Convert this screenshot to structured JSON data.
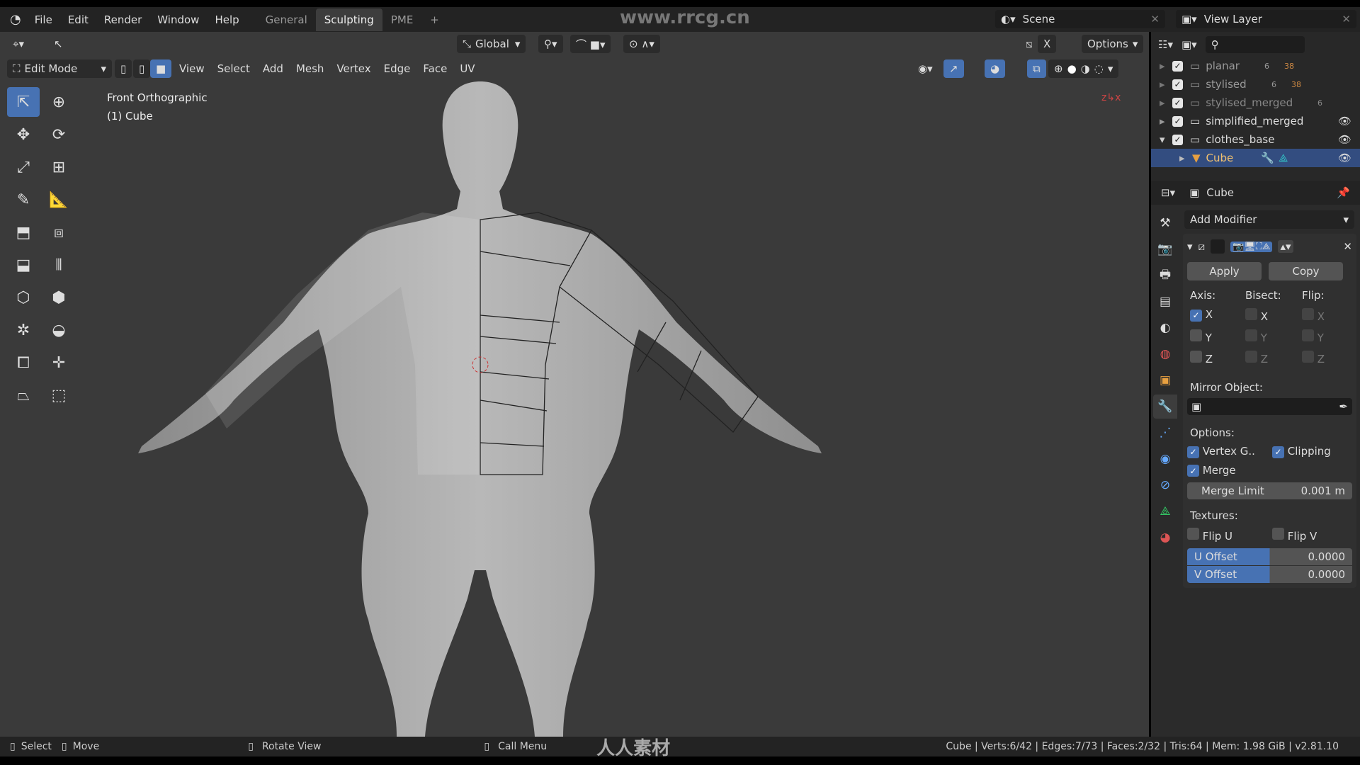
{
  "topbar": {
    "menus": [
      "File",
      "Edit",
      "Render",
      "Window",
      "Help"
    ],
    "workspaces": [
      "General",
      "Sculpting",
      "PME"
    ],
    "active_workspace": "Sculpting",
    "add_tab": "+",
    "watermark": "www.rrcg.cn",
    "scene": "Scene",
    "view_layer": "View Layer"
  },
  "viewport": {
    "orientation": "Global",
    "options": "Options",
    "x_mirror": "X",
    "mode": "Edit Mode",
    "menus": [
      "View",
      "Select",
      "Add",
      "Mesh",
      "Vertex",
      "Edge",
      "Face",
      "UV"
    ],
    "view_name": "Front Orthographic",
    "object_name": "(1) Cube"
  },
  "outliner": {
    "items": [
      {
        "name": "planar",
        "count1": "6",
        "count2": "38"
      },
      {
        "name": "stylised",
        "count1": "6",
        "count2": "38"
      },
      {
        "name": "stylised_merged",
        "count1": "6"
      },
      {
        "name": "simplified_merged"
      },
      {
        "name": "clothes_base"
      },
      {
        "name": "Cube"
      }
    ]
  },
  "properties": {
    "object": "Cube",
    "add_modifier": "Add Modifier",
    "apply": "Apply",
    "copy": "Copy",
    "axis_label": "Axis:",
    "bisect_label": "Bisect:",
    "flip_label": "Flip:",
    "axes": [
      "X",
      "Y",
      "Z"
    ],
    "axis_checked": [
      true,
      false,
      false
    ],
    "mirror_object_label": "Mirror Object:",
    "options_label": "Options:",
    "vertex_groups": "Vertex G..",
    "clipping": "Clipping",
    "merge": "Merge",
    "merge_limit_label": "Merge Limit",
    "merge_limit_value": "0.001 m",
    "textures_label": "Textures:",
    "flip_u": "Flip U",
    "flip_v": "Flip V",
    "u_offset_label": "U Offset",
    "u_offset_value": "0.0000",
    "v_offset_label": "V Offset",
    "v_offset_value": "0.0000"
  },
  "status": {
    "select": "Select",
    "move": "Move",
    "rotate": "Rotate View",
    "call_menu": "Call Menu",
    "logo_text": "人人素材",
    "stats": "Cube | Verts:6/42 | Edges:7/73 | Faces:2/32 | Tris:64 | Mem: 1.98 GiB | v2.81.10"
  },
  "colors": {
    "accent": "#4772b3",
    "viewport_bg": "#3a3a3a",
    "selected_row": "#334d80",
    "object_orange": "#e8a040"
  }
}
